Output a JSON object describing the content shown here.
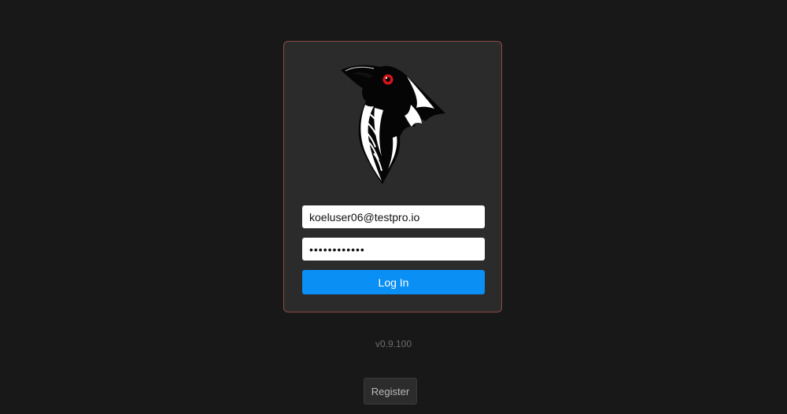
{
  "login": {
    "email_value": "koeluser06@testpro.io",
    "password_value": "••••••••••••",
    "login_label": "Log In"
  },
  "version": "v0.9.100",
  "register_label": "Register",
  "colors": {
    "background": "#181818",
    "card": "#2b2b2b",
    "card_border": "#8a4b45",
    "accent": "#0a8ff5",
    "raven_eye": "#d8141a"
  },
  "logo": {
    "icon": "raven-head-logo"
  }
}
